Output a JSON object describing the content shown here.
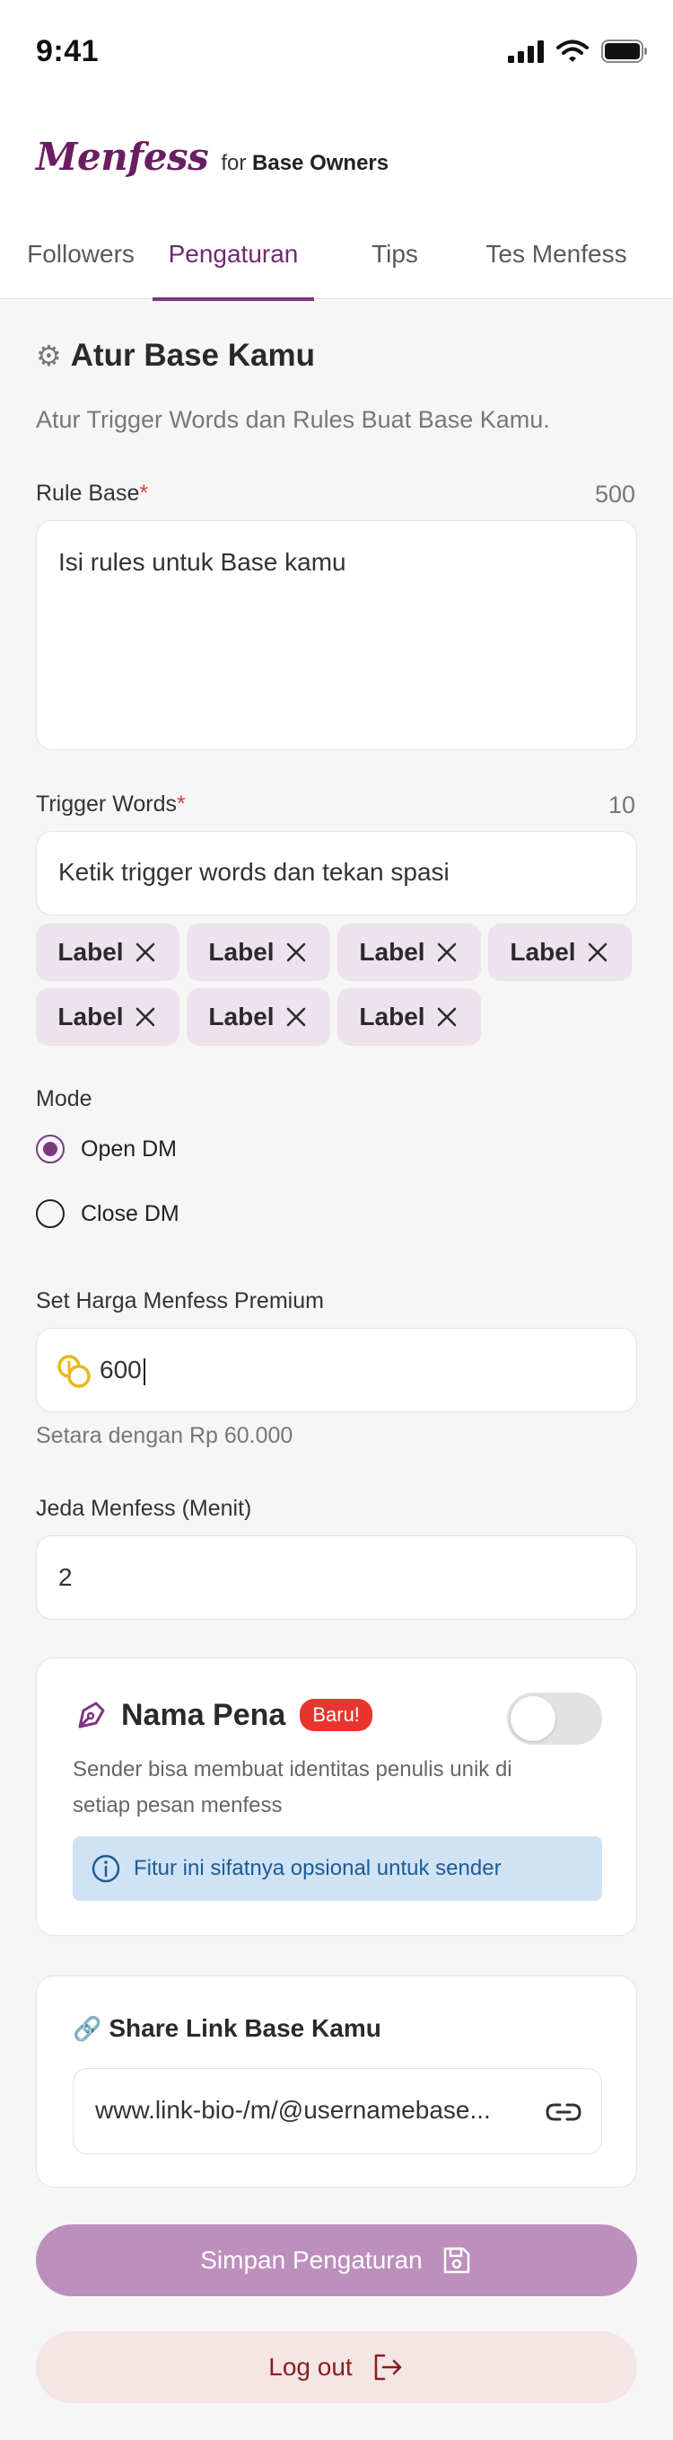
{
  "status": {
    "time": "9:41"
  },
  "brand": {
    "logo": "Menfess",
    "for_prefix": "for",
    "for_bold": "Base Owners"
  },
  "tabs": [
    {
      "label": "Followers",
      "active": false
    },
    {
      "label": "Pengaturan",
      "active": true
    },
    {
      "label": "Tips",
      "active": false
    },
    {
      "label": "Tes Menfess",
      "active": false
    }
  ],
  "settings": {
    "title": "Atur Base Kamu",
    "title_icon": "gear-icon",
    "subtitle": "Atur Trigger Words dan Rules Buat Base Kamu.",
    "rule": {
      "label": "Rule Base",
      "required": "*",
      "counter": "500",
      "value": "Isi rules untuk Base kamu"
    },
    "trigger": {
      "label": "Trigger Words",
      "required": "*",
      "counter": "10",
      "placeholder": "Ketik trigger words dan tekan spasi",
      "chips": [
        "Label",
        "Label",
        "Label",
        "Label",
        "Label",
        "Label",
        "Label"
      ]
    },
    "mode": {
      "label": "Mode",
      "options": [
        {
          "label": "Open DM",
          "selected": true
        },
        {
          "label": "Close DM",
          "selected": false
        }
      ]
    },
    "price": {
      "label": "Set Harga Menfess Premium",
      "value": "600",
      "icon": "coins-icon",
      "hint": "Setara dengan Rp 60.000"
    },
    "delay": {
      "label": "Jeda Menfess (Menit)",
      "value": "2"
    }
  },
  "pen_name": {
    "title": "Nama Pena",
    "badge": "Baru!",
    "enabled": false,
    "description": "Sender bisa membuat identitas penulis unik di setiap pesan menfess",
    "info": "Fitur ini sifatnya opsional untuk sender"
  },
  "share": {
    "title": "Share Link Base Kamu",
    "link": "www.link-bio-/m/@usernamebase..."
  },
  "buttons": {
    "save": "Simpan Pengaturan",
    "logout": "Log out"
  },
  "colors": {
    "brand": "#6a1e62",
    "accent": "#7d3680",
    "save_bg": "#bd8fbc",
    "logout_bg": "#f3e6e4",
    "logout_text": "#8a1d1d",
    "badge": "#e8362f",
    "info_bg": "#cfe3f5"
  }
}
